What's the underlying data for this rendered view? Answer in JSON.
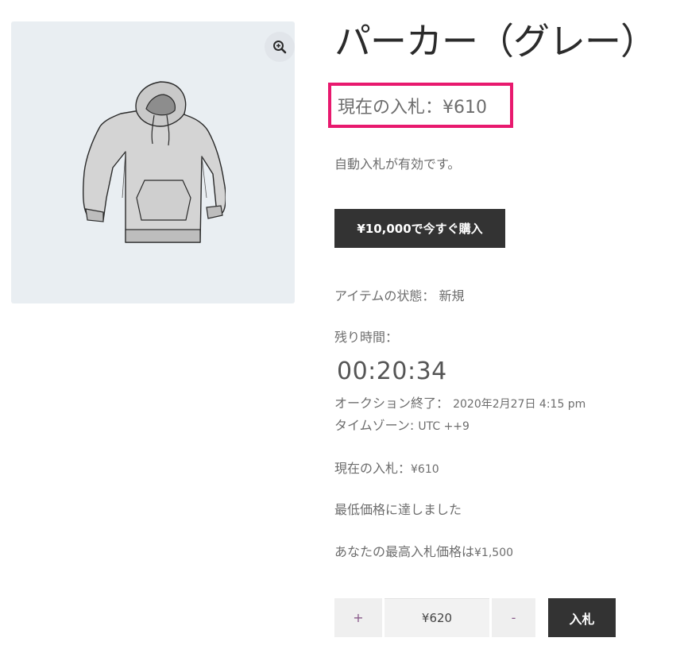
{
  "product": {
    "title": "パーカー（グレー）",
    "current_bid_highlight": "現在の入札：¥610",
    "auto_bid_notice": "自動入札が有効です。",
    "buy_now_label": "¥10,000で今すぐ購入",
    "condition_label": "アイテムの状態：",
    "condition_value": "新規",
    "time_left_label": "残り時間：",
    "countdown": "00:20:34",
    "auction_end_label": "オークション終了：",
    "auction_end_value": "2020年2月27日 4:15 pm",
    "timezone_label": "タイムゾーン:",
    "timezone_value": "UTC ++9",
    "current_bid_label": "現在の入札：",
    "current_bid_value": "¥610",
    "reserve_met": "最低価格に達しました",
    "max_bid_label": "あなたの最高入札価格は",
    "max_bid_value": "¥1,500"
  },
  "bid_form": {
    "plus_label": "+",
    "minus_label": "-",
    "bid_value": "¥620",
    "submit_label": "入札"
  },
  "icons": {
    "zoom": "zoom-in-icon"
  },
  "colors": {
    "highlight_border": "#e8196e",
    "button_dark": "#333333",
    "gallery_bg": "#e9eef2"
  }
}
